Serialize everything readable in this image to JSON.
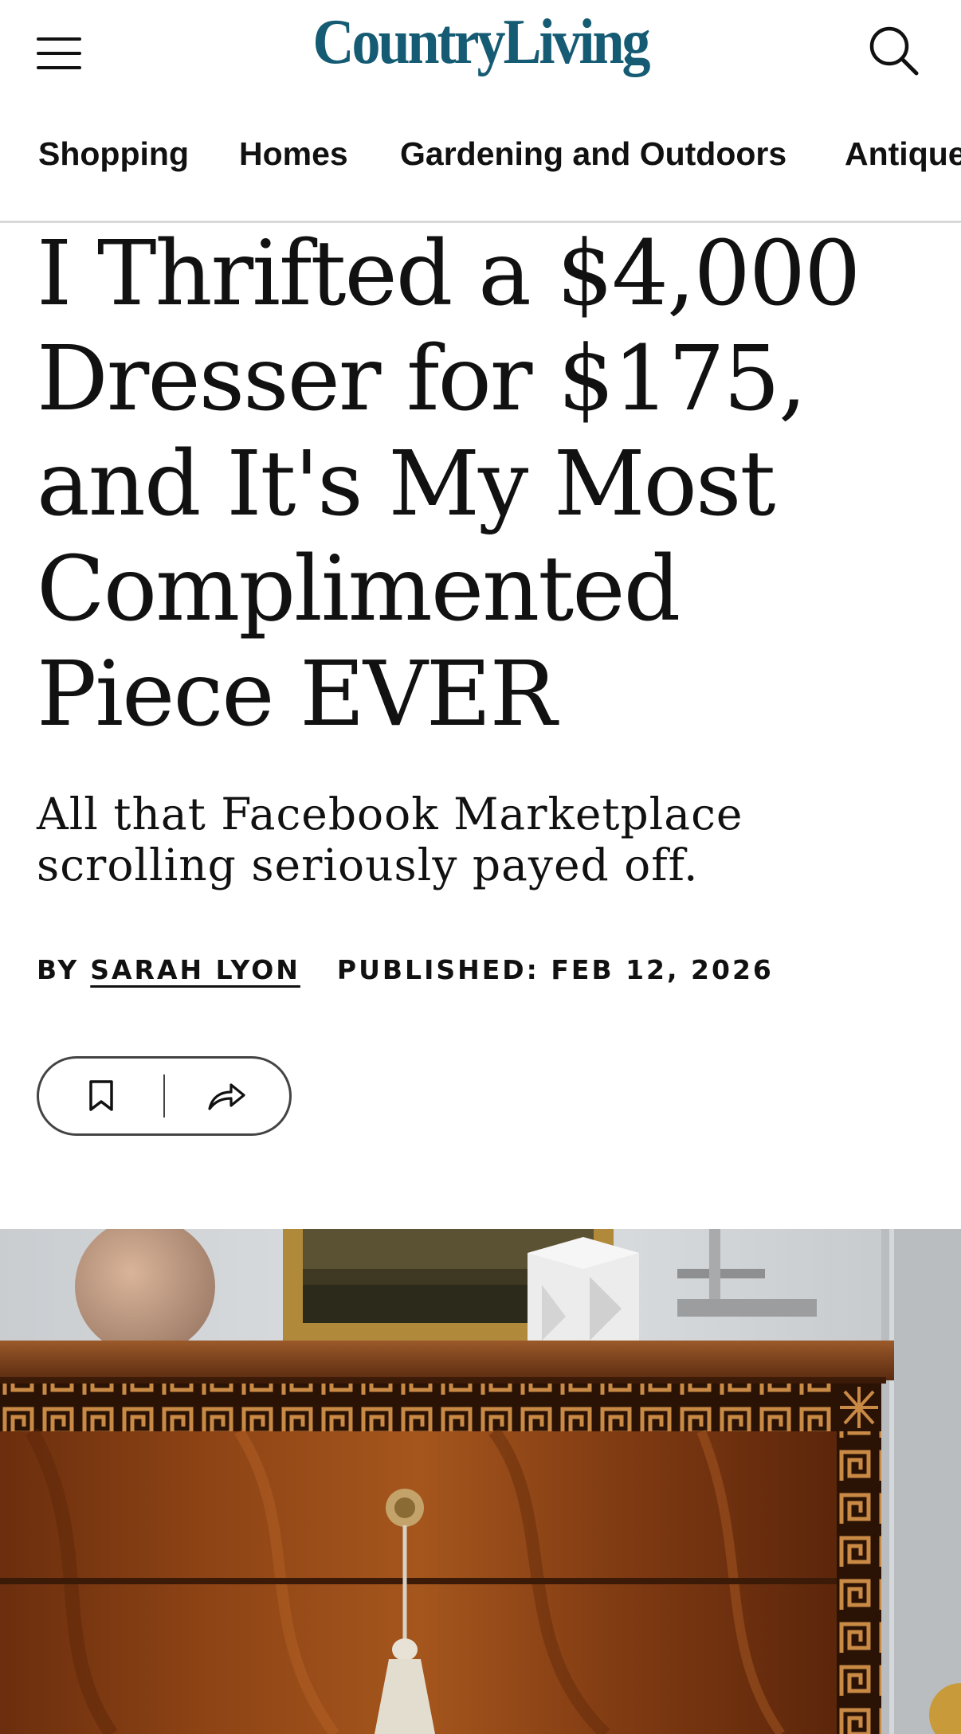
{
  "header": {
    "logo_text": "CountryLiving",
    "menu_icon": "hamburger-menu-icon",
    "search_icon": "search-icon",
    "brand_color": "#155b73"
  },
  "nav": {
    "items": [
      {
        "label": "Shopping"
      },
      {
        "label": "Homes"
      },
      {
        "label": "Gardening and Outdoors"
      },
      {
        "label": "Antiques"
      }
    ]
  },
  "article": {
    "headline": "I Thrifted a $4,000 Dresser for $175, and It's My Most Complimented Piece EVER",
    "dek": "All that Facebook Marketplace scrolling seriously payed off.",
    "byline": {
      "by_label": "BY",
      "author": "SARAH LYON",
      "published": "PUBLISHED: FEB 12, 2026"
    },
    "actions": {
      "save_icon": "bookmark-icon",
      "share_icon": "share-icon"
    }
  }
}
